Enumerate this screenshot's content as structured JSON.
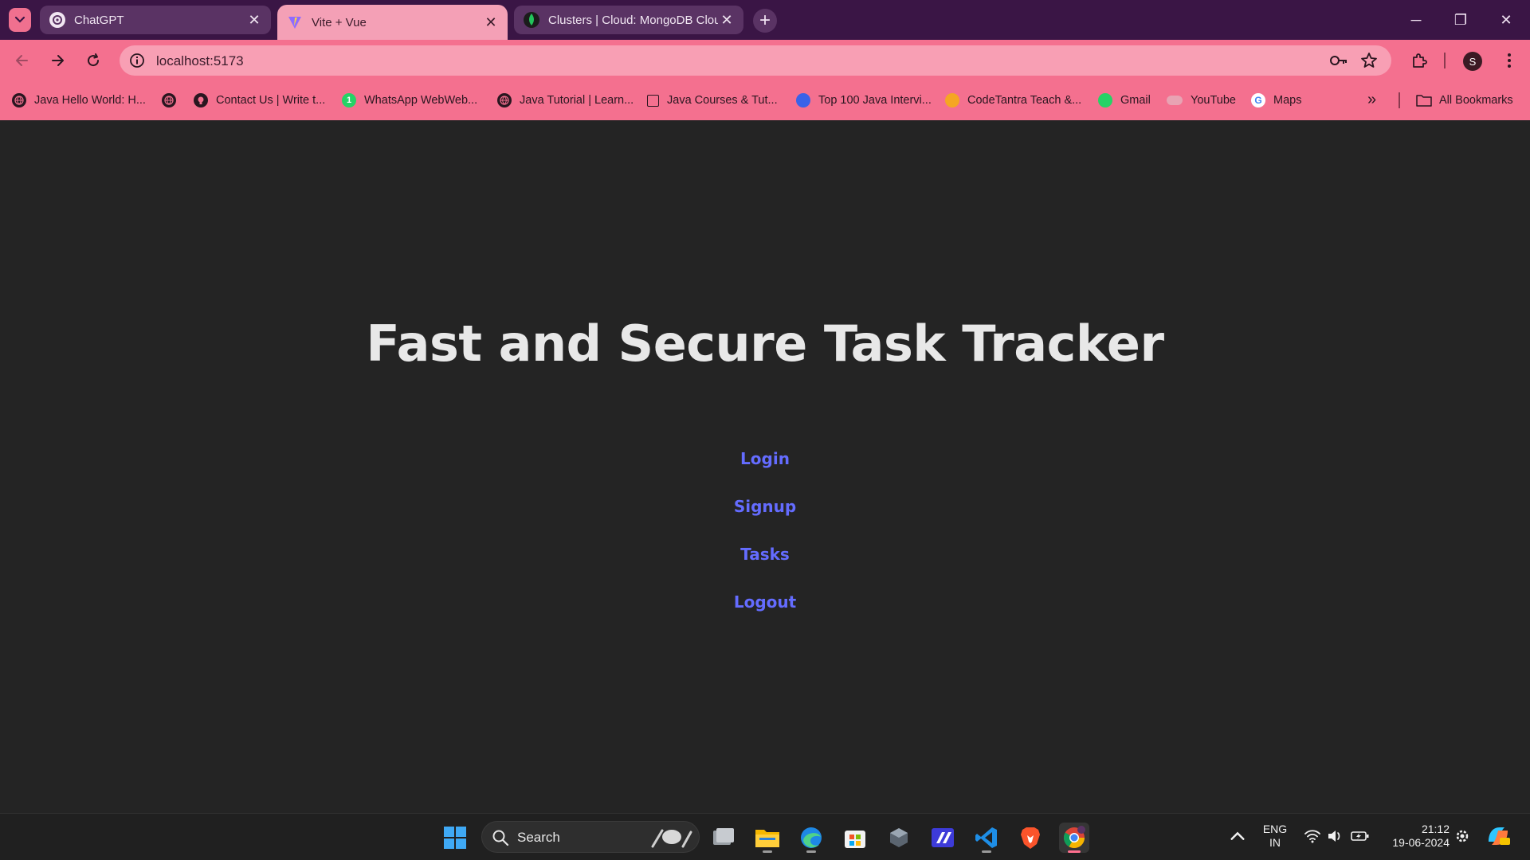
{
  "browser": {
    "tabs": [
      {
        "title": "ChatGPT",
        "icon": "chatgpt-icon",
        "active": false
      },
      {
        "title": "Vite + Vue",
        "icon": "vite-icon",
        "active": true
      },
      {
        "title": "Clusters | Cloud: MongoDB Clou",
        "icon": "mongodb-icon",
        "active": false
      }
    ],
    "url": "localhost:5173",
    "profile_initial": "S",
    "bookmarks": [
      {
        "label": "Java Hello World: H...",
        "icon": "globe-icon"
      },
      {
        "label": "",
        "icon": "globe-icon"
      },
      {
        "label": "Contact Us | Write t...",
        "icon": "github-icon"
      },
      {
        "label": "WhatsApp WebWeb...",
        "icon": "whatsapp-icon"
      },
      {
        "label": "Java Tutorial | Learn...",
        "icon": "globe-icon"
      },
      {
        "label": "Java Courses & Tut...",
        "icon": "course-icon"
      },
      {
        "label": "Top 100 Java Intervi...",
        "icon": "blue-globe-icon"
      },
      {
        "label": "CodeTantra Teach &...",
        "icon": "sun-icon"
      },
      {
        "label": "Gmail",
        "icon": "whatsapp-icon"
      },
      {
        "label": "YouTube",
        "icon": "cloud-icon"
      },
      {
        "label": "Maps",
        "icon": "google-icon"
      }
    ],
    "all_bookmarks_label": "All Bookmarks"
  },
  "page": {
    "title": "Fast and Secure Task Tracker",
    "links": [
      "Login",
      "Signup",
      "Tasks",
      "Logout"
    ],
    "link_color": "#646cff",
    "background": "#242424"
  },
  "taskbar": {
    "search_label": "Search",
    "language_line1": "ENG",
    "language_line2": "IN",
    "time": "21:12",
    "date": "19-06-2024"
  }
}
